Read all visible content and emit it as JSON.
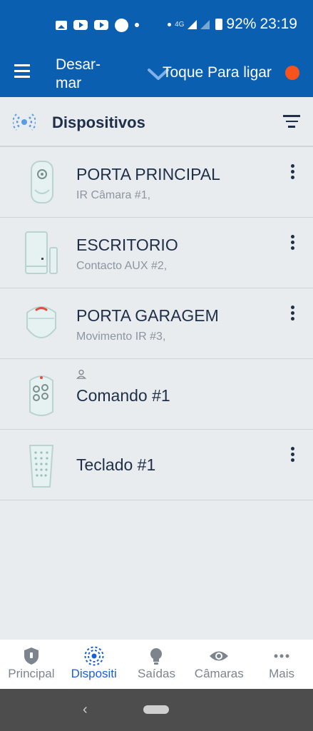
{
  "status_bar": {
    "network": "4G",
    "battery": "92%",
    "time": "23:19"
  },
  "app_bar": {
    "title": "Desar-\nmar",
    "toggle_label": "Toque Para ligar",
    "status_color": "#f7541d"
  },
  "section": {
    "title": "Dispositivos"
  },
  "devices": [
    {
      "name": "PORTA PRINCIPAL",
      "subtitle": "IR Câmara #1,",
      "icon": "camera-sensor-icon"
    },
    {
      "name": "ESCRITORIO",
      "subtitle": "Contacto AUX #2,",
      "icon": "door-contact-icon"
    },
    {
      "name": "PORTA GARAGEM",
      "subtitle": "Movimento IR #3,",
      "icon": "motion-sensor-icon"
    },
    {
      "name": "Comando #1",
      "subtitle": "",
      "icon": "remote-control-icon"
    },
    {
      "name": "Teclado #1",
      "subtitle": "",
      "icon": "keypad-icon"
    }
  ],
  "bottom_nav": [
    {
      "label": "Principal",
      "icon": "shield-icon"
    },
    {
      "label": "Dispositi",
      "icon": "devices-icon",
      "active": true
    },
    {
      "label": "Saídas",
      "icon": "lightbulb-icon"
    },
    {
      "label": "Câmaras",
      "icon": "eye-icon"
    },
    {
      "label": "Mais",
      "icon": "more-horizontal-icon"
    }
  ],
  "colors": {
    "primary": "#0a5fb0",
    "accent": "#1b5fd6",
    "status_off": "#f7541d"
  }
}
